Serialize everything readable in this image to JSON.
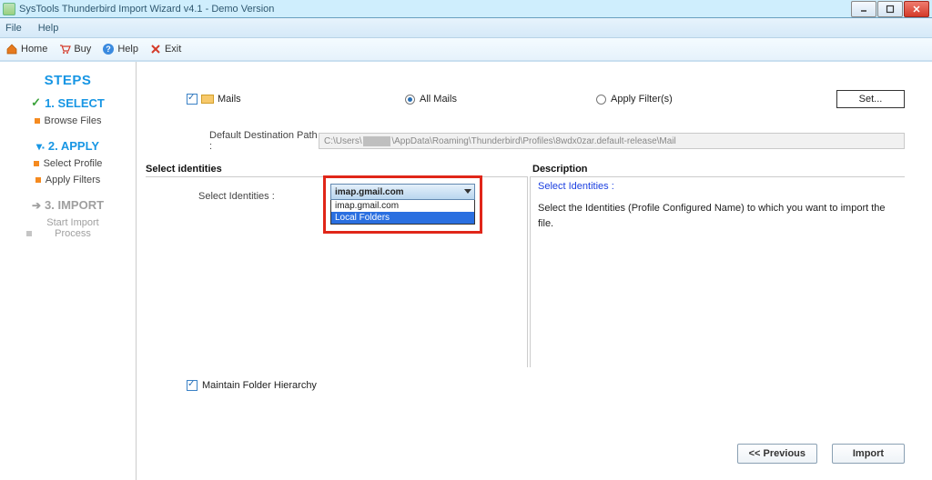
{
  "window": {
    "title": "SysTools Thunderbird Import Wizard v4.1 - Demo Version"
  },
  "menu": {
    "file": "File",
    "help": "Help"
  },
  "toolbar": {
    "home": "Home",
    "buy": "Buy",
    "help": "Help",
    "exit": "Exit"
  },
  "sidebar": {
    "heading": "STEPS",
    "step1": {
      "title": "1. SELECT",
      "sub1": "Browse Files"
    },
    "step2": {
      "title": "2. APPLY",
      "sub1": "Select Profile",
      "sub2": "Apply Filters"
    },
    "step3": {
      "title": "3. IMPORT",
      "sub1": "Start Import Process"
    }
  },
  "main": {
    "mails_label": "Mails",
    "all_mails": "All Mails",
    "apply_filters": "Apply Filter(s)",
    "set_btn": "Set...",
    "default_dest_label": "Default Destination Path :",
    "default_dest_value_pre": "C:\\Users\\",
    "default_dest_value_post": "\\AppData\\Roaming\\Thunderbird\\Profiles\\8wdx0zar.default-release\\Mail",
    "select_identities_section": "Select identities",
    "select_identities_label": "Select Identities :",
    "dropdown": {
      "selected": "imap.gmail.com",
      "options": [
        "imap.gmail.com",
        "Local Folders"
      ]
    },
    "description_section": "Description",
    "description_title": "Select Identities :",
    "description_text": "Select the Identities (Profile Configured Name) to  which  you want to import the file.",
    "maintain_label": "Maintain Folder Hierarchy",
    "prev_btn": "<< Previous",
    "import_btn": "Import"
  }
}
